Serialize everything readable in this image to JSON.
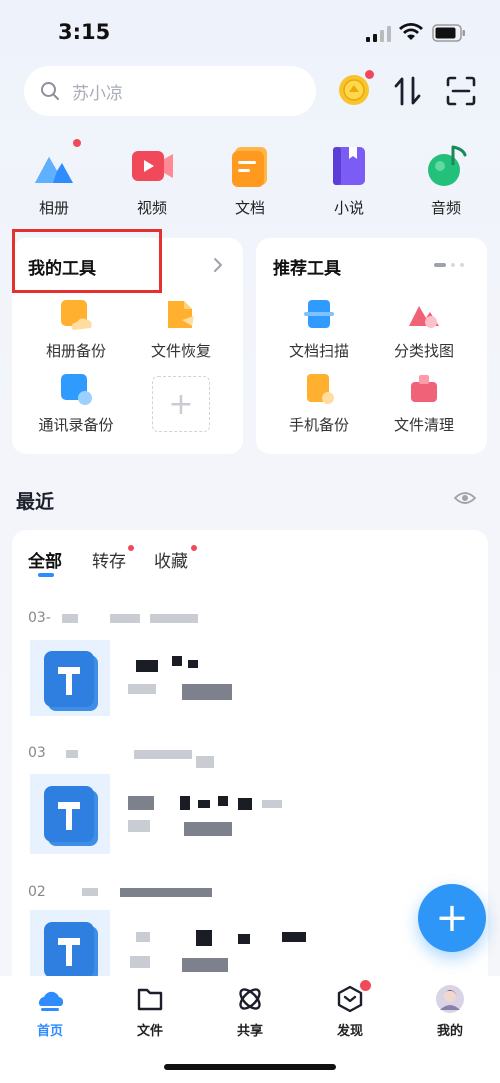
{
  "status": {
    "time": "3:15"
  },
  "search": {
    "placeholder": "苏小凉"
  },
  "header_icons": {
    "coin": "coin-icon",
    "sort": "sort-icon",
    "scan": "scan-icon"
  },
  "categories": [
    {
      "label": "相册",
      "icon": "album-icon",
      "color": "#2f8cff",
      "badge": true
    },
    {
      "label": "视频",
      "icon": "video-icon",
      "color": "#f04a5a",
      "badge": false
    },
    {
      "label": "文档",
      "icon": "document-icon",
      "color": "#ff9a1f",
      "badge": false
    },
    {
      "label": "小说",
      "icon": "novel-icon",
      "color": "#7b5cf5",
      "badge": false
    },
    {
      "label": "音频",
      "icon": "audio-icon",
      "color": "#22c07a",
      "badge": false
    }
  ],
  "my_tools": {
    "title": "我的工具",
    "items": [
      {
        "label": "相册备份",
        "icon": "album-backup-icon"
      },
      {
        "label": "文件恢复",
        "icon": "file-restore-icon"
      },
      {
        "label": "通讯录备份",
        "icon": "contacts-backup-icon"
      }
    ]
  },
  "recommended_tools": {
    "title": "推荐工具",
    "items": [
      {
        "label": "文档扫描",
        "icon": "doc-scan-icon"
      },
      {
        "label": "分类找图",
        "icon": "image-sort-icon"
      },
      {
        "label": "手机备份",
        "icon": "phone-backup-icon"
      },
      {
        "label": "文件清理",
        "icon": "file-clean-icon"
      }
    ]
  },
  "recent": {
    "title": "最近",
    "tabs": [
      {
        "label": "全部",
        "active": true,
        "badge": false
      },
      {
        "label": "转存",
        "active": false,
        "badge": true
      },
      {
        "label": "收藏",
        "active": false,
        "badge": true
      }
    ],
    "items": [
      {
        "date": "03-",
        "icon": "doc-file-icon"
      },
      {
        "date": "03",
        "icon": "doc-file-icon"
      },
      {
        "date": "02",
        "icon": "doc-file-icon"
      }
    ]
  },
  "bottom_nav": [
    {
      "label": "首页",
      "icon": "home-icon",
      "active": true,
      "badge": false
    },
    {
      "label": "文件",
      "icon": "folder-icon",
      "active": false,
      "badge": false
    },
    {
      "label": "共享",
      "icon": "share-icon",
      "active": false,
      "badge": false
    },
    {
      "label": "发现",
      "icon": "discover-icon",
      "active": false,
      "badge": true
    },
    {
      "label": "我的",
      "icon": "avatar",
      "active": false,
      "badge": false
    }
  ],
  "colors": {
    "accent": "#2f8cff",
    "badge": "#f04a5a",
    "highlight_box": "#e5312e"
  }
}
